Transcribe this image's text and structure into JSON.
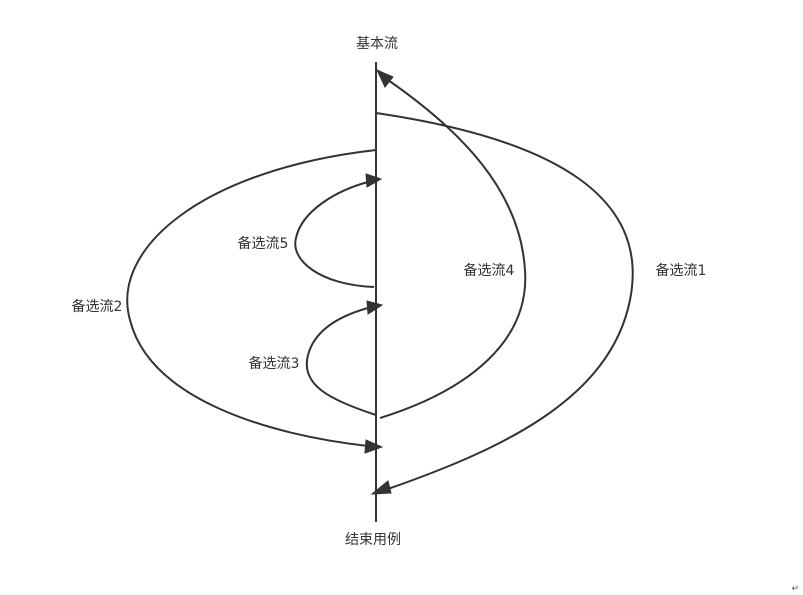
{
  "diagram": {
    "main_flow_top_label": "基本流",
    "main_flow_end_label": "结束用例",
    "alt_flows": [
      {
        "id": "1",
        "label": "备选流1"
      },
      {
        "id": "2",
        "label": "备选流2"
      },
      {
        "id": "3",
        "label": "备选流3"
      },
      {
        "id": "4",
        "label": "备选流4"
      },
      {
        "id": "5",
        "label": "备选流5"
      }
    ],
    "return_mark": "↵",
    "colors": {
      "line": "#333333",
      "text": "#333333",
      "background": "#ffffff"
    }
  }
}
